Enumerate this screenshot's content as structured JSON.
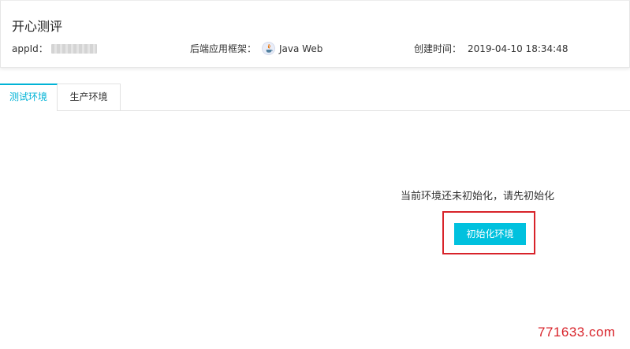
{
  "app": {
    "title": "开心测评"
  },
  "meta": {
    "appid_label": "appId：",
    "framework_label": "后端应用框架：",
    "framework_icon": "java-icon",
    "framework_value": "Java Web",
    "created_label": "创建时间：",
    "created_value": "2019-04-10 18:34:48"
  },
  "tabs": [
    {
      "label": "测试环境",
      "active": true
    },
    {
      "label": "生产环境",
      "active": false
    }
  ],
  "main": {
    "empty_message": "当前环境还未初始化，请先初始化",
    "init_button_label": "初始化环境"
  },
  "colors": {
    "accent": "#00c1de",
    "active_tab": "#00b3d6",
    "highlight": "#d8232a"
  },
  "watermark": "771633.com"
}
